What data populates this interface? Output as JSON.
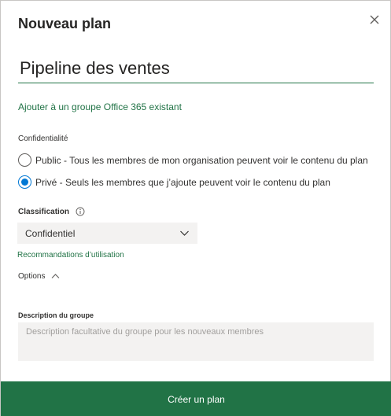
{
  "dialog": {
    "title": "Nouveau plan",
    "close_icon": "close-icon"
  },
  "plan_name": {
    "value": "Pipeline des ventes"
  },
  "group_link": "Ajouter à un groupe Office 365 existant",
  "privacy": {
    "label": "Confidentialité",
    "options": [
      {
        "label": "Public - Tous les membres de mon organisation peuvent voir le contenu du plan",
        "checked": false
      },
      {
        "label": "Privé - Seuls les membres que j’ajoute peuvent voir le contenu du plan",
        "checked": true
      }
    ]
  },
  "classification": {
    "label": "Classification",
    "info_icon": "info-icon",
    "selected": "Confidentiel",
    "recommendations_link": "Recommandations d’utilisation"
  },
  "options_toggle": {
    "label": "Options",
    "icon": "chevron-up-icon"
  },
  "description": {
    "label": "Description du groupe",
    "value": "",
    "placeholder": "Description facultative du groupe pour les nouveaux membres"
  },
  "create_button": "Créer un plan",
  "colors": {
    "accent": "#217346",
    "radio_selected": "#0078d4",
    "field_background": "#f3f2f1"
  }
}
